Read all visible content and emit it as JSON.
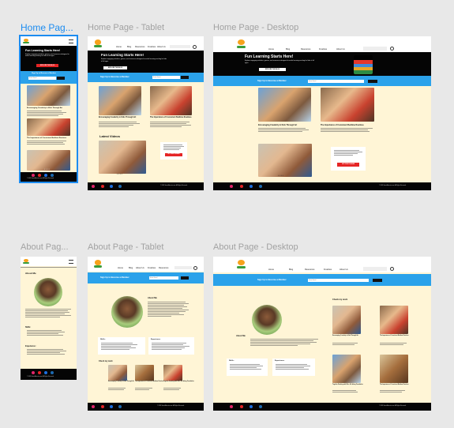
{
  "frames": {
    "home_mobile": "Home Pag...",
    "home_tablet": "Home Page - Tablet",
    "home_desktop": "Home Page - Desktop",
    "about_mobile": "About Pag...",
    "about_tablet": "About Page - Tablet",
    "about_desktop": "About Page - Desktop"
  },
  "nav": {
    "items": [
      "Home",
      "Blog",
      "Resources",
      "Freebies",
      "About Us"
    ]
  },
  "hero": {
    "title": "Fun Learning Starts Here!",
    "subtitle": "Explore engaging activities, games, and resources designed to make learning exciting for kids of all ages.",
    "cta": "EXPLORE THE BLOG"
  },
  "newsletter": {
    "title": "Sign Up to Become a Member",
    "email_placeholder": "Enter Email",
    "submit": "SUBMIT"
  },
  "posts": [
    {
      "title": "Encouraging Creativity in Kids Through Art"
    },
    {
      "title": "The Importance of Consistent Bedtime Routines"
    }
  ],
  "latest_videos": "Latest Videos",
  "promo": {
    "cta": "GET FREE PLANNER"
  },
  "about": {
    "heading": "About Me",
    "skills": "Skills:",
    "experience": "Experience:",
    "check_my_work": "Check my work"
  },
  "about_posts": [
    {
      "title": "Encouraging Creativity in Kids Through Art"
    },
    {
      "title": "The Importance of Consistent Bedtime Routines"
    },
    {
      "title": "Together Reading with Kids: A Lifelong Foundation"
    },
    {
      "title": "The Importance of Consistent Bedtime Routines"
    }
  ],
  "footer": {
    "copyright": "© 2024 SmartEducate.com. All Rights Reserved."
  },
  "colors": {
    "accent": "#2ba2ea",
    "background": "#fff5d6",
    "dark": "#050505",
    "cta": "#e52525",
    "selection": "#1c8cf0"
  }
}
